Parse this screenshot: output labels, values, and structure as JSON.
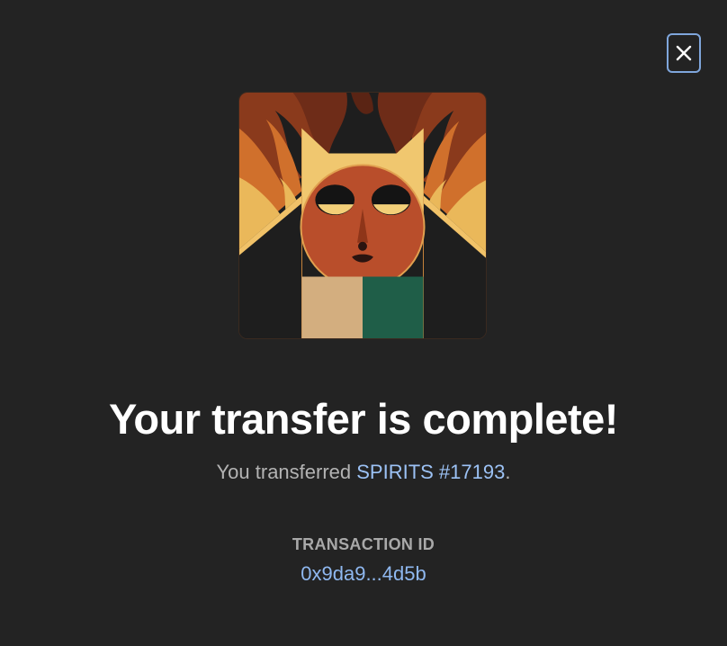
{
  "modal": {
    "close_label": "×",
    "nft": {
      "collection": "SPIRITS",
      "token": "#17193"
    },
    "title": "Your transfer is complete!",
    "subtitle_prefix": "You transferred ",
    "subtitle_link": "SPIRITS #17193",
    "subtitle_suffix": ".",
    "tx_label": "TRANSACTION ID",
    "tx_id": "0x9da9...4d5b"
  },
  "colors": {
    "background": "#232323",
    "link": "#9cc2f5",
    "close_border": "#7fa6dc",
    "title": "#ffffff",
    "muted_text": "#b3b3b3"
  },
  "icons": {
    "close": "close-icon"
  }
}
